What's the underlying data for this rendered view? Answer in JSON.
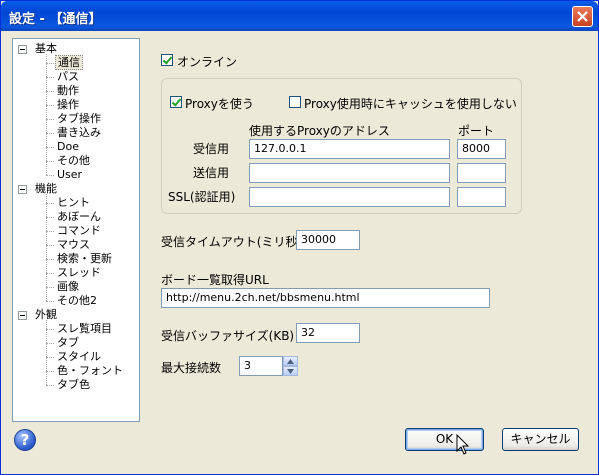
{
  "window": {
    "title": "設定 - 【通信】"
  },
  "tree": {
    "groups": [
      {
        "label": "基本",
        "items": [
          "通信",
          "パス",
          "動作",
          "操作",
          "タブ操作",
          "書き込み",
          "Doe",
          "その他",
          "User"
        ]
      },
      {
        "label": "機能",
        "items": [
          "ヒント",
          "あぼーん",
          "コマンド",
          "マウス",
          "検索・更新",
          "スレッド",
          "画像",
          "その他2"
        ]
      },
      {
        "label": "外観",
        "items": [
          "スレ覧項目",
          "タブ",
          "スタイル",
          "色・フォント",
          "タブ色"
        ]
      }
    ],
    "selected": "通信"
  },
  "online": {
    "label": "オンライン",
    "checked": true
  },
  "proxy": {
    "use_label": "Proxyを使う",
    "use_checked": true,
    "nocache_label": "Proxy使用時にキャッシュを使用しない",
    "nocache_checked": false,
    "col_address": "使用するProxyのアドレス",
    "col_port": "ポート",
    "receive_label": "受信用",
    "receive_address": "127.0.0.1",
    "receive_port": "8000",
    "send_label": "送信用",
    "send_address": "",
    "send_port": "",
    "ssl_label": "SSL(認証用)",
    "ssl_address": "",
    "ssl_port": ""
  },
  "timeout": {
    "label": "受信タイムアウト(ミリ秒)",
    "value": "30000"
  },
  "board": {
    "label": "ボード一覧取得URL",
    "value": "http://menu.2ch.net/bbsmenu.html"
  },
  "buffer": {
    "label": "受信バッファサイズ(KB)",
    "value": "32"
  },
  "maxconn": {
    "label": "最大接続数",
    "value": "3"
  },
  "buttons": {
    "ok": "OK",
    "cancel": "キャンセル",
    "help": "?"
  },
  "colors": {
    "titlebar": "#0054e3",
    "face": "#ece9d8",
    "border": "#7f9db9"
  }
}
